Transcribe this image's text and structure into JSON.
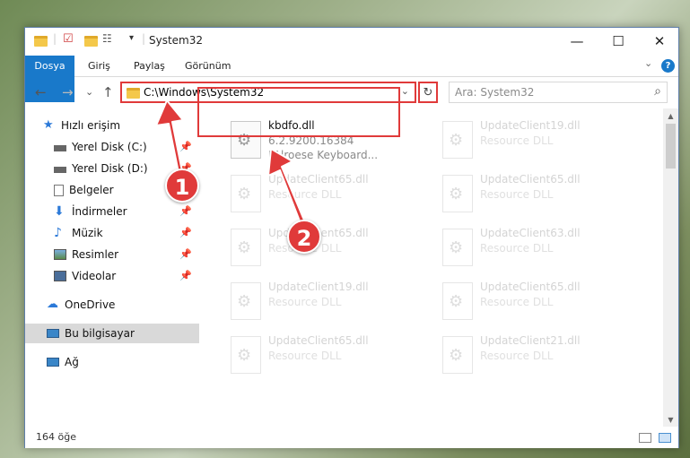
{
  "window": {
    "title": "System32",
    "minimize": "—",
    "maximize": "☐",
    "close": "✕"
  },
  "ribbon": {
    "tabs": [
      "Dosya",
      "Giriş",
      "Paylaş",
      "Görünüm"
    ],
    "collapse": "⌄",
    "help": "?"
  },
  "nav": {
    "back": "←",
    "forward": "→",
    "recent": "⌄",
    "up": "↑",
    "address": "C:\\Windows\\System32",
    "address_dropdown": "⌄",
    "refresh": "↻",
    "search_placeholder": "Ara: System32",
    "search_icon": "⌕"
  },
  "sidebar": {
    "items": [
      {
        "label": "Hızlı erişim",
        "icon": "star-icon"
      },
      {
        "label": "Yerel Disk (C:)",
        "icon": "drive-icon"
      },
      {
        "label": "Yerel Disk (D:)",
        "icon": "drive-icon"
      },
      {
        "label": "Belgeler",
        "icon": "documents-icon"
      },
      {
        "label": "İndirmeler",
        "icon": "download-icon"
      },
      {
        "label": "Müzik",
        "icon": "music-icon"
      },
      {
        "label": "Resimler",
        "icon": "pictures-icon"
      },
      {
        "label": "Videolar",
        "icon": "videos-icon"
      },
      {
        "label": "OneDrive",
        "icon": "cloud-icon"
      },
      {
        "label": "Bu bilgisayar",
        "icon": "computer-icon"
      },
      {
        "label": "Ağ",
        "icon": "network-icon"
      }
    ],
    "pin": "📌"
  },
  "files": {
    "main": {
      "name": "kbdfo.dll",
      "version": "6.2.9200.16384",
      "desc": "FAlroese Keyboard..."
    },
    "faded": [
      {
        "name": "UpdateClient19.dll",
        "desc": "Resource DLL"
      },
      {
        "name": "UpdateClient65.dll",
        "desc": "Resource DLL"
      },
      {
        "name": "UpdateClient65.dll",
        "desc": "Resource DLL"
      },
      {
        "name": "UpdateClient65.dll",
        "desc": "Resource DLL"
      },
      {
        "name": "UpdateClient63.dll",
        "desc": "Resource DLL"
      },
      {
        "name": "UpdateClient19.dll",
        "desc": "Resource DLL"
      },
      {
        "name": "UpdateClient65.dll",
        "desc": "Resource DLL"
      },
      {
        "name": "UpdateClient65.dll",
        "desc": "Resource DLL"
      },
      {
        "name": "UpdateClient21.dll",
        "desc": "Resource DLL"
      }
    ]
  },
  "status": {
    "count": "164 öğe"
  },
  "callouts": {
    "one": "1",
    "two": "2"
  },
  "colors": {
    "accent": "#1979ca",
    "highlight": "#e03a3a"
  }
}
